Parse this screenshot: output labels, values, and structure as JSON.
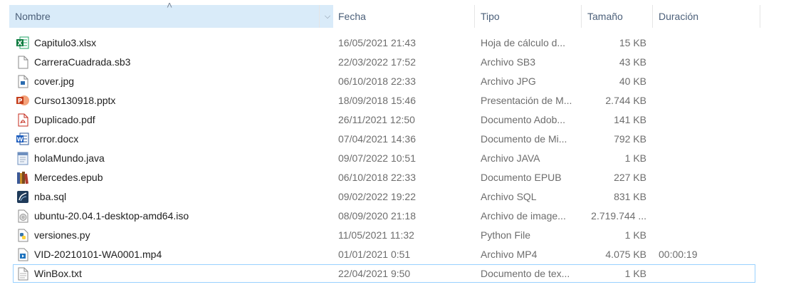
{
  "columns": {
    "name": "Nombre",
    "date": "Fecha",
    "type": "Tipo",
    "size": "Tamaño",
    "duration": "Duración"
  },
  "files": [
    {
      "icon": "excel-file-icon",
      "name": "Capitulo3.xlsx",
      "date": "16/05/2021 21:43",
      "type": "Hoja de cálculo d...",
      "size": "15 KB",
      "duration": ""
    },
    {
      "icon": "generic-file-icon",
      "name": "CarreraCuadrada.sb3",
      "date": "22/03/2022 17:52",
      "type": "Archivo SB3",
      "size": "43 KB",
      "duration": ""
    },
    {
      "icon": "image-file-icon",
      "name": "cover.jpg",
      "date": "06/10/2018 22:33",
      "type": "Archivo JPG",
      "size": "40 KB",
      "duration": ""
    },
    {
      "icon": "powerpoint-file-icon",
      "name": "Curso130918.pptx",
      "date": "18/09/2018 15:46",
      "type": "Presentación de M...",
      "size": "2.744 KB",
      "duration": ""
    },
    {
      "icon": "pdf-file-icon",
      "name": "Duplicado.pdf",
      "date": "26/11/2021 12:50",
      "type": "Documento Adob...",
      "size": "141 KB",
      "duration": ""
    },
    {
      "icon": "word-file-icon",
      "name": "error.docx",
      "date": "07/04/2021 14:36",
      "type": "Documento de Mi...",
      "size": "792 KB",
      "duration": ""
    },
    {
      "icon": "java-file-icon",
      "name": "holaMundo.java",
      "date": "09/07/2022 10:51",
      "type": "Archivo JAVA",
      "size": "1 KB",
      "duration": ""
    },
    {
      "icon": "epub-file-icon",
      "name": "Mercedes.epub",
      "date": "06/10/2018 22:33",
      "type": "Documento EPUB",
      "size": "227 KB",
      "duration": ""
    },
    {
      "icon": "sql-file-icon",
      "name": "nba.sql",
      "date": "09/02/2022 19:22",
      "type": "Archivo SQL",
      "size": "831 KB",
      "duration": ""
    },
    {
      "icon": "disc-image-file-icon",
      "name": "ubuntu-20.04.1-desktop-amd64.iso",
      "date": "08/09/2020 21:18",
      "type": "Archivo de image...",
      "size": "2.719.744 ...",
      "duration": ""
    },
    {
      "icon": "python-file-icon",
      "name": "versiones.py",
      "date": "11/05/2021 11:32",
      "type": "Python File",
      "size": "1 KB",
      "duration": ""
    },
    {
      "icon": "video-file-icon",
      "name": "VID-20210101-WA0001.mp4",
      "date": "01/01/2021 0:51",
      "type": "Archivo MP4",
      "size": "4.075 KB",
      "duration": "00:00:19"
    },
    {
      "icon": "text-file-icon",
      "name": "WinBox.txt",
      "date": "22/04/2021 9:50",
      "type": "Documento de tex...",
      "size": "1 KB",
      "duration": ""
    }
  ],
  "colors": {
    "header_selected_bg": "#d9ebf9",
    "header_text": "#4c607a",
    "focus_border": "#99d1ff",
    "secondary_text": "#6d6d6d"
  }
}
